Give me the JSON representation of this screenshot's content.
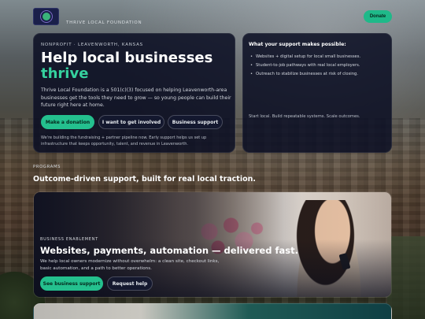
{
  "brand": {
    "name": "THRIVE LOCAL FOUNDATION",
    "logo_icon": "thrive-logo-icon"
  },
  "header": {
    "donate_label": "Donate"
  },
  "hero": {
    "kicker": "NONPROFIT · LEAVENWORTH, KANSAS",
    "title": "Help local businesses",
    "title_accent": "thrive",
    "description": "Thrive Local Foundation is a 501(c)(3) focused on helping Leavenworth-area businesses get the tools they need to grow — so young people can build their future right here at home.",
    "buttons": {
      "donation": "Make a donation",
      "involved": "I want to get involved",
      "support": "Business support"
    },
    "note": "We're building the fundraising + partner pipeline now. Early support helps us set up infrastructure that keeps opportunity, talent, and revenue in Leavenworth."
  },
  "side": {
    "title": "What your support makes possible:",
    "items": [
      "Websites + digital setup for local small businesses.",
      "Student-to-job pathways with real local employers.",
      "Outreach to stabilize businesses at risk of closing."
    ],
    "footer": "Start local. Build repeatable systems. Scale outcomes."
  },
  "programs": {
    "kicker": "PROGRAMS",
    "title": "Outcome-driven support, built for real local traction."
  },
  "business_card": {
    "kicker": "BUSINESS ENABLEMENT",
    "title": "Websites, payments, automation — delivered fast.",
    "description": "We help local owners modernize without overwhelm: a clean site, checkout links, basic automation, and a path to better operations.",
    "buttons": {
      "see_support": "See business support",
      "request_help": "Request help"
    }
  },
  "colors": {
    "accent": "#24c08e",
    "accent_text": "#35d19e",
    "card_bg": "#0a0e23"
  }
}
